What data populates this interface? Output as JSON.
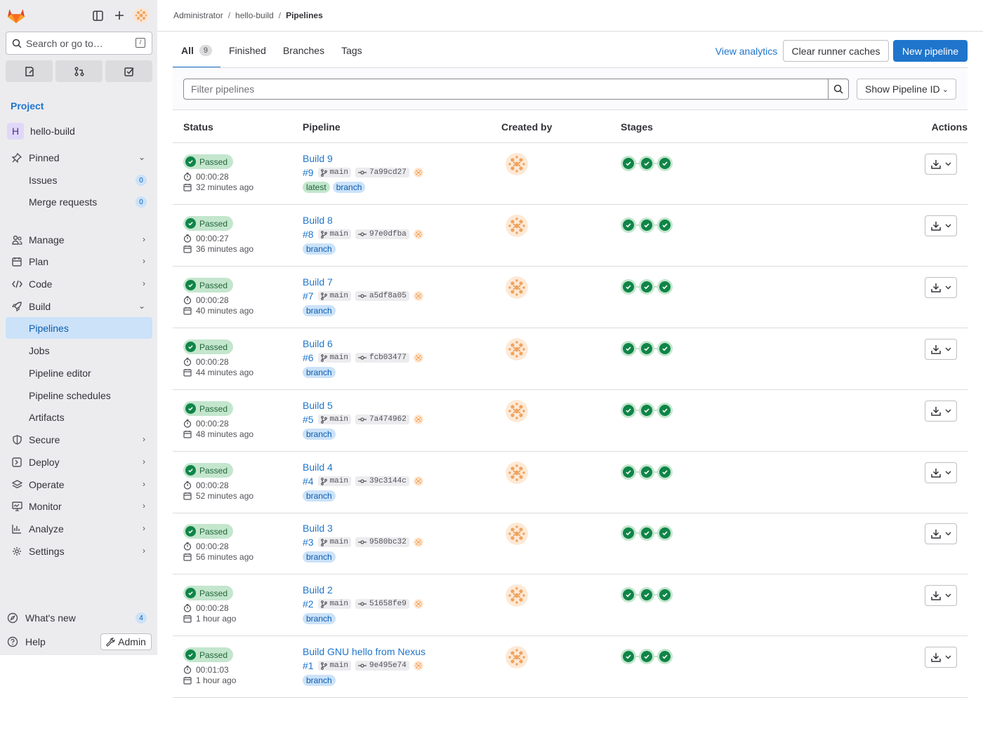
{
  "sidebar": {
    "search_placeholder": "Search or go to…",
    "search_shortcut": "/",
    "section_title": "Project",
    "project": {
      "initial": "H",
      "name": "hello-build"
    },
    "pinned": {
      "label": "Pinned",
      "items": [
        {
          "label": "Issues",
          "count": "0"
        },
        {
          "label": "Merge requests",
          "count": "0"
        }
      ]
    },
    "nav": [
      {
        "label": "Manage",
        "icon": "users-icon"
      },
      {
        "label": "Plan",
        "icon": "calendar-icon"
      },
      {
        "label": "Code",
        "icon": "code-icon"
      },
      {
        "label": "Build",
        "icon": "rocket-icon",
        "expanded": true
      }
    ],
    "build_items": [
      "Pipelines",
      "Jobs",
      "Pipeline editor",
      "Pipeline schedules",
      "Artifacts"
    ],
    "nav2": [
      {
        "label": "Secure",
        "icon": "shield-icon"
      },
      {
        "label": "Deploy",
        "icon": "deploy-icon"
      },
      {
        "label": "Operate",
        "icon": "cloud-icon"
      },
      {
        "label": "Monitor",
        "icon": "monitor-icon"
      },
      {
        "label": "Analyze",
        "icon": "chart-icon"
      },
      {
        "label": "Settings",
        "icon": "gear-icon"
      }
    ],
    "whats_new": {
      "label": "What's new",
      "count": "4"
    },
    "help": "Help",
    "admin": "Admin"
  },
  "breadcrumb": [
    "Administrator",
    "hello-build",
    "Pipelines"
  ],
  "tabs": [
    {
      "label": "All",
      "count": "9"
    },
    {
      "label": "Finished"
    },
    {
      "label": "Branches"
    },
    {
      "label": "Tags"
    }
  ],
  "buttons": {
    "view_analytics": "View analytics",
    "clear_caches": "Clear runner caches",
    "new_pipeline": "New pipeline"
  },
  "filter": {
    "placeholder": "Filter pipelines",
    "select": "Show Pipeline ID"
  },
  "table": {
    "headers": [
      "Status",
      "Pipeline",
      "Created by",
      "Stages",
      "Actions"
    ],
    "rows": [
      {
        "status": "Passed",
        "duration": "00:00:28",
        "ago": "32 minutes ago",
        "title": "Build 9",
        "id": "#9",
        "branch": "main",
        "sha": "7a99cd27",
        "tags": [
          "latest",
          "branch"
        ]
      },
      {
        "status": "Passed",
        "duration": "00:00:27",
        "ago": "36 minutes ago",
        "title": "Build 8",
        "id": "#8",
        "branch": "main",
        "sha": "97e0dfba",
        "tags": [
          "branch"
        ]
      },
      {
        "status": "Passed",
        "duration": "00:00:28",
        "ago": "40 minutes ago",
        "title": "Build 7",
        "id": "#7",
        "branch": "main",
        "sha": "a5df8a05",
        "tags": [
          "branch"
        ]
      },
      {
        "status": "Passed",
        "duration": "00:00:28",
        "ago": "44 minutes ago",
        "title": "Build 6",
        "id": "#6",
        "branch": "main",
        "sha": "fcb03477",
        "tags": [
          "branch"
        ]
      },
      {
        "status": "Passed",
        "duration": "00:00:28",
        "ago": "48 minutes ago",
        "title": "Build 5",
        "id": "#5",
        "branch": "main",
        "sha": "7a474962",
        "tags": [
          "branch"
        ]
      },
      {
        "status": "Passed",
        "duration": "00:00:28",
        "ago": "52 minutes ago",
        "title": "Build 4",
        "id": "#4",
        "branch": "main",
        "sha": "39c3144c",
        "tags": [
          "branch"
        ]
      },
      {
        "status": "Passed",
        "duration": "00:00:28",
        "ago": "56 minutes ago",
        "title": "Build 3",
        "id": "#3",
        "branch": "main",
        "sha": "9580bc32",
        "tags": [
          "branch"
        ]
      },
      {
        "status": "Passed",
        "duration": "00:00:28",
        "ago": "1 hour ago",
        "title": "Build 2",
        "id": "#2",
        "branch": "main",
        "sha": "51658fe9",
        "tags": [
          "branch"
        ]
      },
      {
        "status": "Passed",
        "duration": "00:01:03",
        "ago": "1 hour ago",
        "title": "Build GNU hello from Nexus",
        "id": "#1",
        "branch": "main",
        "sha": "9e495e74",
        "tags": [
          "branch"
        ]
      }
    ]
  },
  "colors": {
    "accent": "#1f75cb",
    "success": "#108548",
    "avatar": "#f0a35e"
  }
}
